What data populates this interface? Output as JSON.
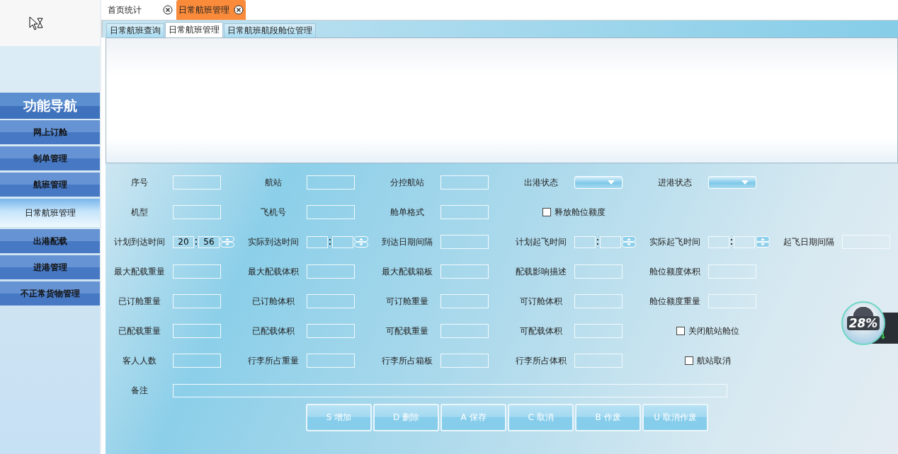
{
  "sidebar": {
    "title": "功能导航",
    "items": [
      {
        "label": "网上订舱",
        "selected": false
      },
      {
        "label": "制单管理",
        "selected": false
      },
      {
        "label": "航班管理",
        "selected": false
      },
      {
        "label": "日常航班管理",
        "selected": true
      },
      {
        "label": "出港配载",
        "selected": false
      },
      {
        "label": "进港管理",
        "selected": false
      },
      {
        "label": "不正常货物管理",
        "selected": false
      }
    ]
  },
  "tabs": [
    {
      "label": "首页统计",
      "selected": false
    },
    {
      "label": "日常航班管理",
      "selected": true
    }
  ],
  "subtabs": [
    {
      "label": "日常航班查询",
      "selected": false
    },
    {
      "label": "日常航班管理",
      "selected": true
    },
    {
      "label": "日常航班航段舱位管理",
      "selected": false
    }
  ],
  "form": {
    "rows": [
      [
        {
          "kind": "field",
          "label": "序号"
        },
        {
          "kind": "field",
          "label": "航站"
        },
        {
          "kind": "field",
          "label": "分控航站"
        },
        {
          "kind": "select",
          "label": "出港状态"
        },
        {
          "kind": "select",
          "label": "进港状态"
        }
      ],
      [
        {
          "kind": "field",
          "label": "机型"
        },
        {
          "kind": "field",
          "label": "飞机号"
        },
        {
          "kind": "field",
          "label": "舱单格式"
        },
        {
          "kind": "checkbox",
          "label": "释放舱位额度",
          "checked": false
        }
      ],
      [
        {
          "kind": "time",
          "label": "计划到达时间",
          "hour": "20",
          "minute": "56"
        },
        {
          "kind": "time",
          "label": "实际到达时间"
        },
        {
          "kind": "field",
          "label": "到达日期间隔"
        },
        {
          "kind": "time",
          "label": "计划起飞时间"
        },
        {
          "kind": "time",
          "label": "实际起飞时间"
        },
        {
          "kind": "field",
          "label": "起飞日期间隔"
        }
      ],
      [
        {
          "kind": "field",
          "label": "最大配载重量"
        },
        {
          "kind": "field",
          "label": "最大配载体积"
        },
        {
          "kind": "field",
          "label": "最大配载箱板"
        },
        {
          "kind": "field",
          "label": "配载影响描述"
        },
        {
          "kind": "field",
          "label": "舱位额度体积"
        }
      ],
      [
        {
          "kind": "field",
          "label": "已订舱重量"
        },
        {
          "kind": "field",
          "label": "已订舱体积"
        },
        {
          "kind": "field",
          "label": "可订舱重量"
        },
        {
          "kind": "field",
          "label": "可订舱体积"
        },
        {
          "kind": "field",
          "label": "舱位额度重量"
        }
      ],
      [
        {
          "kind": "field",
          "label": "已配载重量"
        },
        {
          "kind": "field",
          "label": "已配载体积"
        },
        {
          "kind": "field",
          "label": "可配载重量"
        },
        {
          "kind": "field",
          "label": "可配载体积"
        },
        {
          "kind": "checkbox",
          "label": "关闭航站舱位",
          "checked": false
        }
      ],
      [
        {
          "kind": "field",
          "label": "客人人数"
        },
        {
          "kind": "field",
          "label": "行李所占重量"
        },
        {
          "kind": "field",
          "label": "行李所占箱板"
        },
        {
          "kind": "field",
          "label": "行李所占体积"
        },
        {
          "kind": "checkbox",
          "label": "航站取消",
          "checked": false
        }
      ],
      [
        {
          "kind": "remark",
          "label": "备注"
        }
      ]
    ]
  },
  "buttons": [
    "S 增加",
    "D 删除",
    "A 保存",
    "C 取消",
    "B 作废",
    "U 取消作废"
  ],
  "overlay": {
    "reading": "28%"
  }
}
